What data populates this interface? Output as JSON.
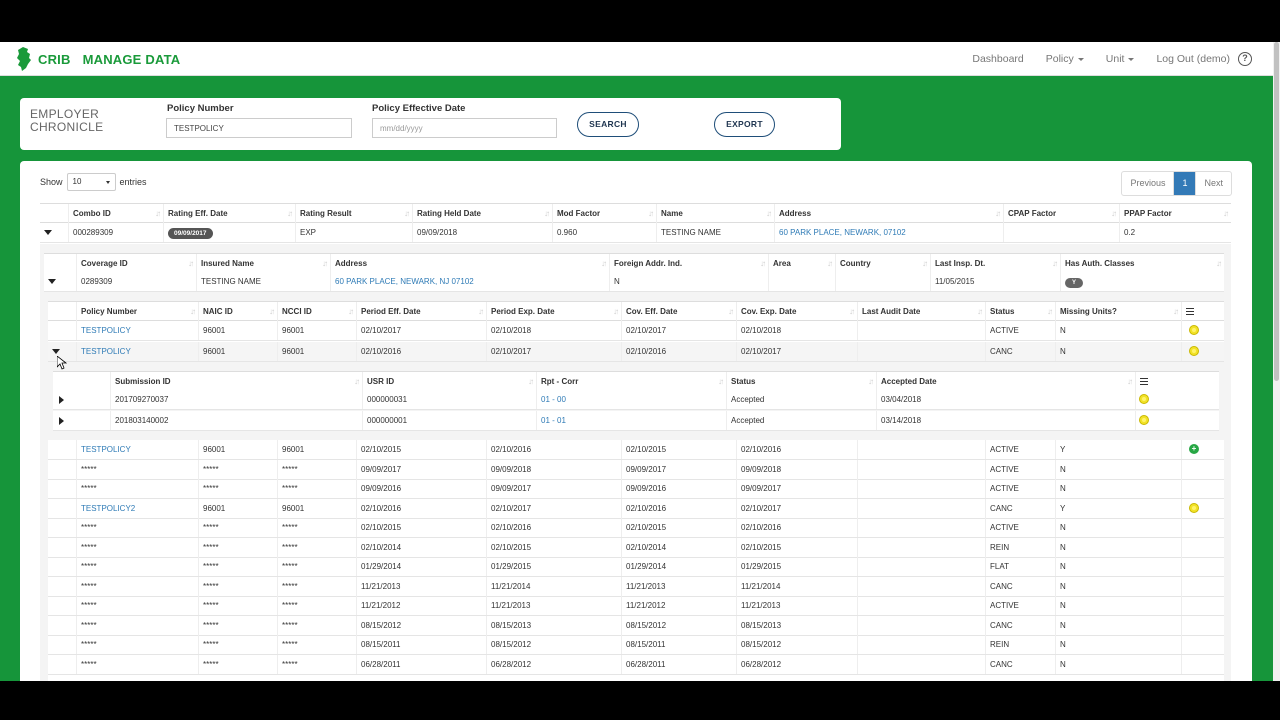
{
  "nav": {
    "brand": "CRIB",
    "app_title": "MANAGE DATA",
    "links": [
      "Dashboard",
      "Policy",
      "Unit",
      "Log Out (demo)"
    ],
    "help": "?"
  },
  "filter": {
    "title_line1": "EMPLOYER",
    "title_line2": "CHRONICLE",
    "policy_number_label": "Policy Number",
    "policy_number_value": "TESTPOLICY",
    "effective_date_label": "Policy Effective Date",
    "effective_date_placeholder": "mm/dd/yyyy",
    "search_label": "SEARCH",
    "export_label": "EXPORT"
  },
  "table_controls": {
    "show_label": "Show",
    "entries_value": "10",
    "entries_label": "entries",
    "prev_label": "Previous",
    "page": "1",
    "next_label": "Next"
  },
  "combo_table": {
    "headers": [
      "Combo ID",
      "Rating Eff. Date",
      "Rating Result",
      "Rating Held Date",
      "Mod Factor",
      "Name",
      "Address",
      "CPAP Factor",
      "PPAP Factor"
    ],
    "row": [
      "000289309",
      "09/09/2017",
      "EXP",
      "09/09/2018",
      "0.960",
      "TESTING NAME",
      "60 PARK PLACE, NEWARK, 07102",
      "",
      "0.2"
    ]
  },
  "coverage_table": {
    "headers": [
      "Coverage ID",
      "Insured Name",
      "Address",
      "Foreign Addr. Ind.",
      "Area",
      "Country",
      "Last Insp. Dt.",
      "Has Auth. Classes"
    ],
    "row": [
      "0289309",
      "TESTING NAME",
      "60 PARK PLACE, NEWARK, NJ 07102",
      "N",
      "",
      "",
      "11/05/2015",
      "Y"
    ]
  },
  "policy_table": {
    "headers": [
      "Policy Number",
      "NAIC ID",
      "NCCI ID",
      "Period Eff. Date",
      "Period Exp. Date",
      "Cov. Eff. Date",
      "Cov. Exp. Date",
      "Last Audit Date",
      "Status",
      "Missing Units?"
    ],
    "rows_top": [
      [
        "TESTPOLICY",
        "96001",
        "96001",
        "02/10/2017",
        "02/10/2018",
        "02/10/2017",
        "02/10/2018",
        "",
        "ACTIVE",
        "N"
      ],
      [
        "TESTPOLICY",
        "96001",
        "96001",
        "02/10/2016",
        "02/10/2017",
        "02/10/2016",
        "02/10/2017",
        "",
        "CANC",
        "N"
      ]
    ],
    "rows_bottom": [
      [
        "TESTPOLICY",
        "96001",
        "96001",
        "02/10/2015",
        "02/10/2016",
        "02/10/2015",
        "02/10/2016",
        "",
        "ACTIVE",
        "Y"
      ],
      [
        "*****",
        "*****",
        "*****",
        "09/09/2017",
        "09/09/2018",
        "09/09/2017",
        "09/09/2018",
        "",
        "ACTIVE",
        "N"
      ],
      [
        "*****",
        "*****",
        "*****",
        "09/09/2016",
        "09/09/2017",
        "09/09/2016",
        "09/09/2017",
        "",
        "ACTIVE",
        "N"
      ],
      [
        "TESTPOLICY2",
        "96001",
        "96001",
        "02/10/2016",
        "02/10/2017",
        "02/10/2016",
        "02/10/2017",
        "",
        "CANC",
        "Y"
      ],
      [
        "*****",
        "*****",
        "*****",
        "02/10/2015",
        "02/10/2016",
        "02/10/2015",
        "02/10/2016",
        "",
        "ACTIVE",
        "N"
      ],
      [
        "*****",
        "*****",
        "*****",
        "02/10/2014",
        "02/10/2015",
        "02/10/2014",
        "02/10/2015",
        "",
        "REIN",
        "N"
      ],
      [
        "*****",
        "*****",
        "*****",
        "01/29/2014",
        "01/29/2015",
        "01/29/2014",
        "01/29/2015",
        "",
        "FLAT",
        "N"
      ],
      [
        "*****",
        "*****",
        "*****",
        "11/21/2013",
        "11/21/2014",
        "11/21/2013",
        "11/21/2014",
        "",
        "CANC",
        "N"
      ],
      [
        "*****",
        "*****",
        "*****",
        "11/21/2012",
        "11/21/2013",
        "11/21/2012",
        "11/21/2013",
        "",
        "ACTIVE",
        "N"
      ],
      [
        "*****",
        "*****",
        "*****",
        "08/15/2012",
        "08/15/2013",
        "08/15/2012",
        "08/15/2013",
        "",
        "CANC",
        "N"
      ],
      [
        "*****",
        "*****",
        "*****",
        "08/15/2011",
        "08/15/2012",
        "08/15/2011",
        "08/15/2012",
        "",
        "REIN",
        "N"
      ],
      [
        "*****",
        "*****",
        "*****",
        "06/28/2011",
        "06/28/2012",
        "06/28/2011",
        "06/28/2012",
        "",
        "CANC",
        "N"
      ]
    ]
  },
  "submission_table": {
    "headers": [
      "Submission ID",
      "USR ID",
      "Rpt - Corr",
      "Status",
      "Accepted Date"
    ],
    "rows": [
      [
        "201709270037",
        "000000031",
        "01 - 00",
        "Accepted",
        "03/04/2018"
      ],
      [
        "201803140002",
        "000000001",
        "01 - 01",
        "Accepted",
        "03/14/2018"
      ]
    ]
  }
}
